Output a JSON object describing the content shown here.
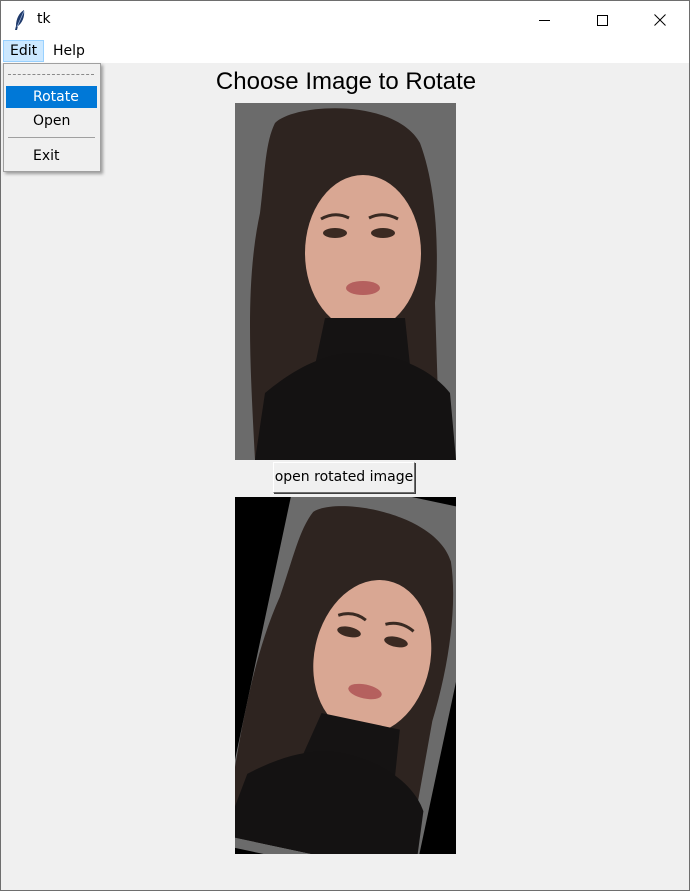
{
  "window": {
    "title": "tk"
  },
  "menubar": {
    "edit": "Edit",
    "help": "Help"
  },
  "edit_menu": {
    "items": [
      "Rotate",
      "Open",
      "Exit"
    ],
    "highlighted": "Rotate",
    "highlight_color": "#0078d7"
  },
  "main": {
    "heading": "Choose Image to Rotate",
    "open_button": "open rotated image"
  },
  "icons": {
    "app": "feather-icon",
    "minimize": "minimize-icon",
    "maximize": "maximize-icon",
    "close": "close-icon"
  }
}
